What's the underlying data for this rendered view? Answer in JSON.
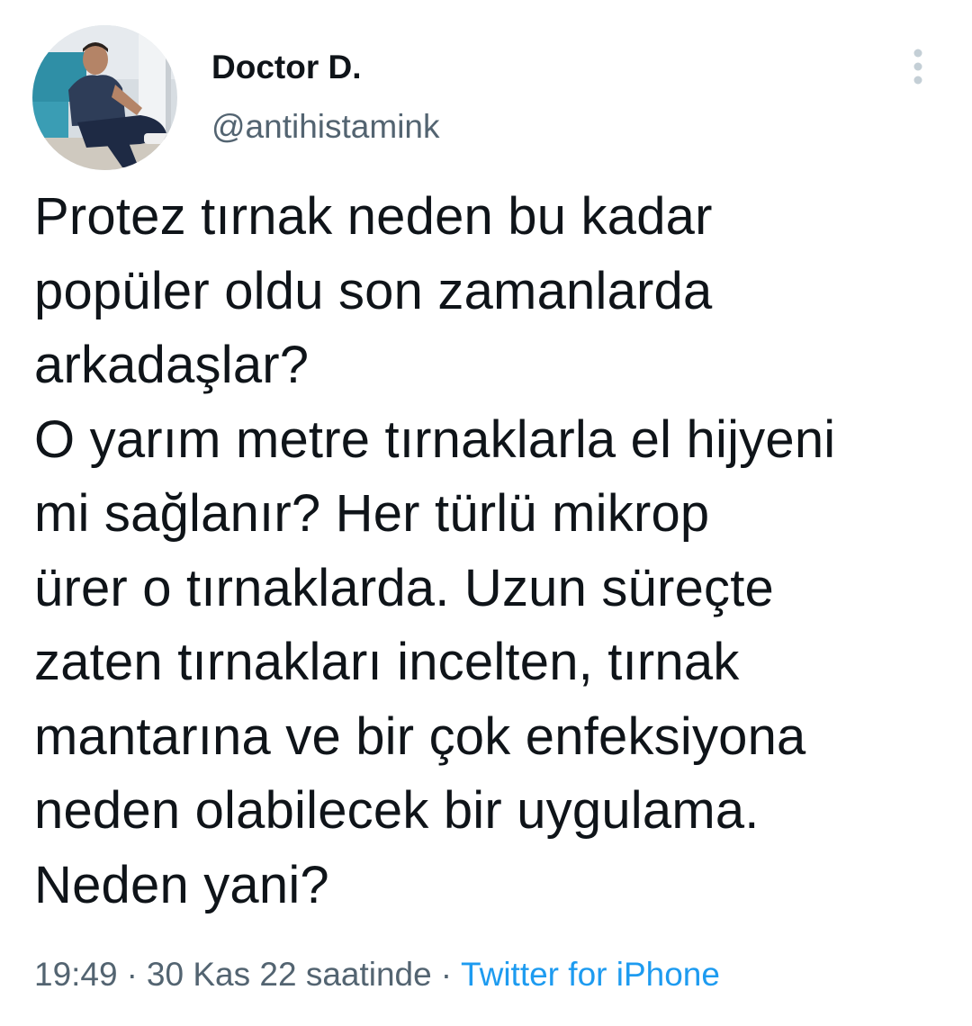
{
  "author": {
    "display_name": "Doctor D.",
    "handle": "@antihistamink",
    "avatar_icon": "profile-photo"
  },
  "more_icon": "vertical-ellipsis-icon",
  "tweet": {
    "text": "Protez tırnak neden bu kadar\npopüler oldu son zamanlarda\narkadaşlar?\nO yarım metre tırnaklarla el hijyeni\nmi sağlanır? Her türlü mikrop\nürer o tırnaklarda. Uzun süreçte\nzaten tırnakları incelten, tırnak\nmantarına ve bir çok enfeksiyona\nneden olabilecek bir uygulama.\nNeden yani?"
  },
  "meta": {
    "time": "19:49",
    "date": "30 Kas 22 saatinde",
    "separator": "·",
    "source": "Twitter for iPhone"
  },
  "colors": {
    "text": "#0f1419",
    "secondary": "#536471",
    "link": "#1d9bf0"
  }
}
